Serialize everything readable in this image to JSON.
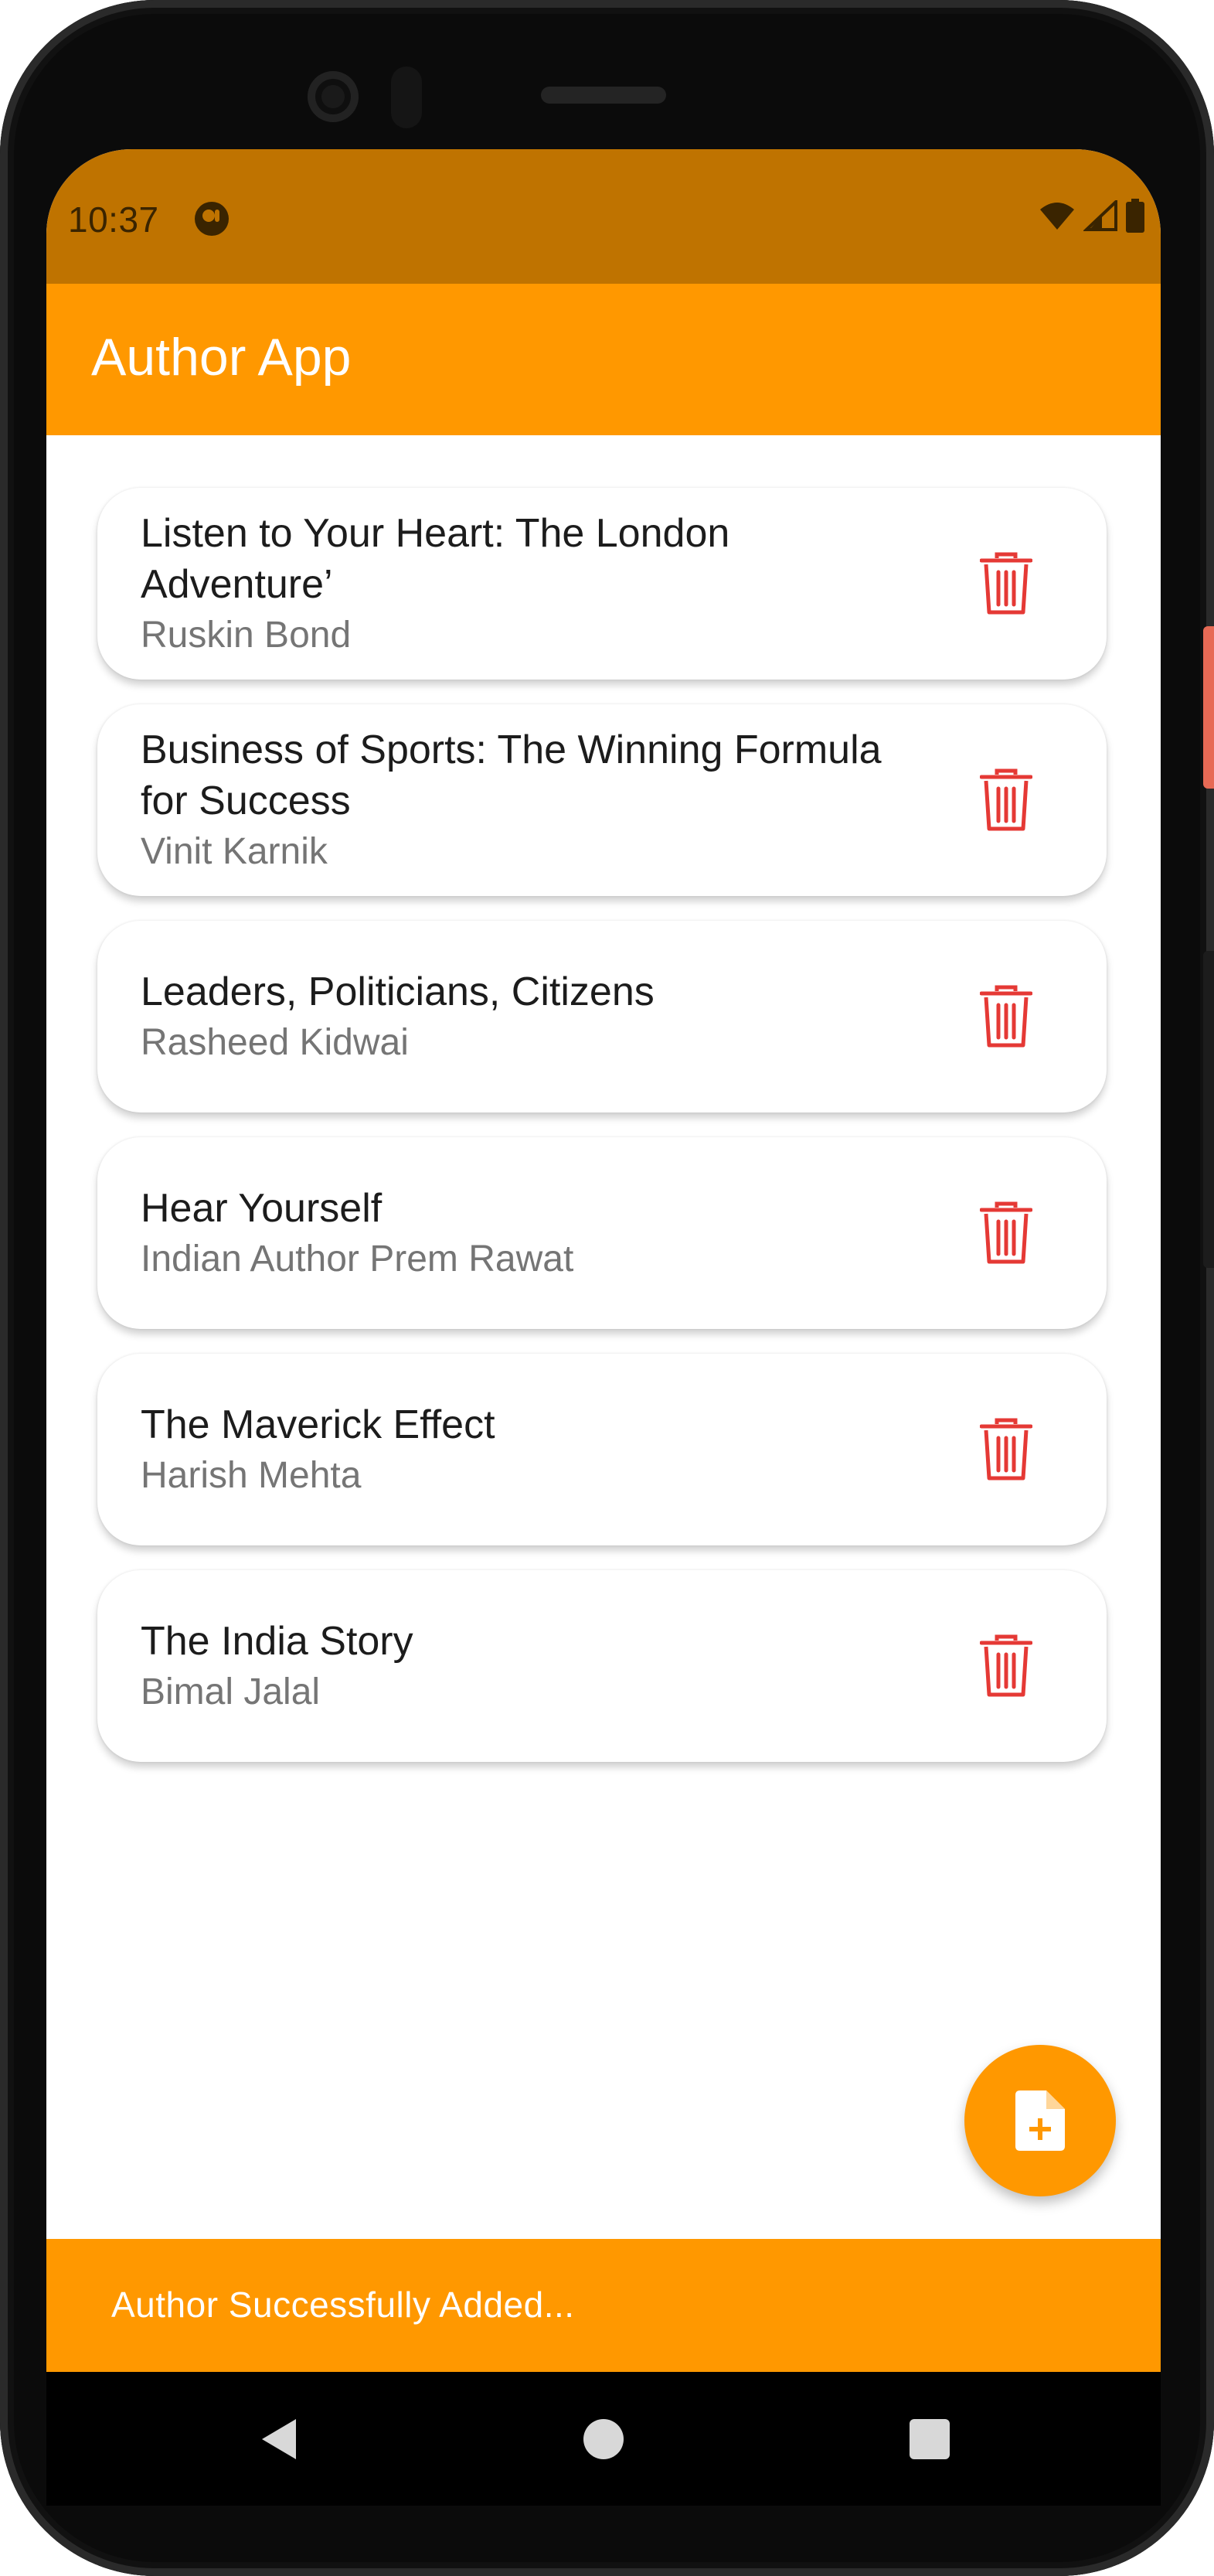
{
  "status_bar": {
    "time": "10:37",
    "icons": [
      "app-notification-icon",
      "wifi-icon",
      "signal-icon",
      "battery-icon"
    ]
  },
  "app_bar": {
    "title": "Author App"
  },
  "authors": [
    {
      "title": "Listen to Your Heart: The London Adventure’",
      "author": "Ruskin Bond"
    },
    {
      "title": "Business of Sports: The Winning Formula for Success",
      "author": "Vinit Karnik"
    },
    {
      "title": "Leaders, Politicians, Citizens",
      "author": "Rasheed Kidwai"
    },
    {
      "title": "Hear Yourself",
      "author": "Indian Author Prem Rawat"
    },
    {
      "title": "The Maverick Effect",
      "author": "Harish Mehta"
    },
    {
      "title": "The India Story",
      "author": "Bimal Jalal"
    }
  ],
  "fab": {
    "icon": "add-document-icon"
  },
  "snackbar": {
    "message": "Author Successfully Added..."
  },
  "nav_bar": {
    "buttons": [
      "back-icon",
      "home-icon",
      "recents-icon"
    ]
  },
  "colors": {
    "primary": "#ff9800",
    "status_bar": "#bf7300",
    "delete": "#e53935",
    "title_text": "#1c1c1c",
    "subtitle_text": "#757575"
  }
}
